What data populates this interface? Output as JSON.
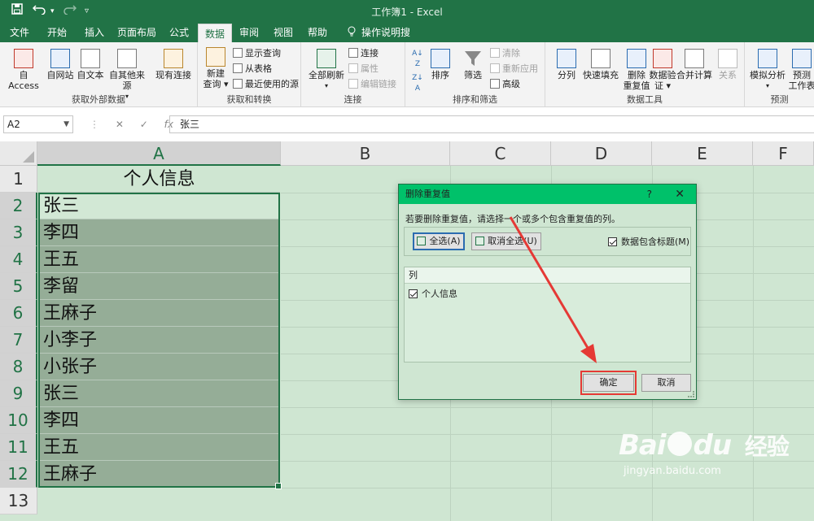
{
  "titlebar": {
    "doc_title": "工作簿1  -  Excel",
    "save_icon": "save-icon",
    "undo_icon": "undo-icon",
    "redo_icon": "redo-icon",
    "customize_icon": "customize-icon"
  },
  "tabs": [
    "文件",
    "开始",
    "插入",
    "页面布局",
    "公式",
    "数据",
    "审阅",
    "视图",
    "帮助",
    "操作说明搜索"
  ],
  "active_tab": "数据",
  "ribbon": {
    "get_external": {
      "label": "获取外部数据",
      "access": "自 Access",
      "web": "自网站",
      "text": "自文本",
      "other": "自其他来源",
      "existing": "现有连接"
    },
    "transform": {
      "label": "获取和转换",
      "new_query": "新建",
      "new_query2": "查询",
      "show_queries": "显示查询",
      "from_table": "从表格",
      "recent": "最近使用的源"
    },
    "connections": {
      "label": "连接",
      "refresh_all": "全部刷新",
      "conn": "连接",
      "props": "属性",
      "edit_links": "编辑链接"
    },
    "sort_filter": {
      "label": "排序和筛选",
      "sort": "排序",
      "filter": "筛选",
      "clear": "清除",
      "reapply": "重新应用",
      "advanced": "高级"
    },
    "data_tools": {
      "label": "数据工具",
      "text_to_cols": "分列",
      "flash_fill": "快速填充",
      "remove_dup": "删除",
      "remove_dup2": "重复值",
      "validation": "数据验",
      "validation2": "证",
      "consolidate": "合并计算",
      "relations": "关系"
    },
    "forecast": {
      "label": "预测",
      "what_if": "模拟分析",
      "forecast_sheet": "预测",
      "forecast_sheet2": "工作表"
    }
  },
  "formula_bar": {
    "name_box": "A2",
    "cancel": "✕",
    "enter": "✓",
    "fx": "fx",
    "content": "张三"
  },
  "grid": {
    "columns": [
      "A",
      "B",
      "C",
      "D",
      "E",
      "F"
    ],
    "rows": [
      "1",
      "2",
      "3",
      "4",
      "5",
      "6",
      "7",
      "8",
      "9",
      "10",
      "11",
      "12",
      "13"
    ],
    "col_a": [
      "个人信息",
      "张三",
      "李四",
      "王五",
      "李留",
      "王麻子",
      "小李子",
      "小张子",
      "张三",
      "李四",
      "王五",
      "王麻子"
    ]
  },
  "dialog": {
    "title": "删除重复值",
    "help": "?",
    "close": "✕",
    "instruction": "若要删除重复值，请选择一个或多个包含重复值的列。",
    "select_all": "全选(A)",
    "unselect_all": "取消全选(U)",
    "has_headers": "数据包含标题(M)",
    "list_header": "列",
    "list_items": [
      "个人信息"
    ],
    "ok": "确定",
    "cancel": "取消"
  },
  "watermark": {
    "logo_left": "Bai",
    "logo_right": "du",
    "logo_suffix": "经验",
    "url": "jingyan.baidu.com"
  },
  "colors": {
    "excel_green": "#217346",
    "dialog_title": "#00c16a",
    "highlight_red": "#e53935",
    "sheet_tint": "#cfe6d2"
  }
}
